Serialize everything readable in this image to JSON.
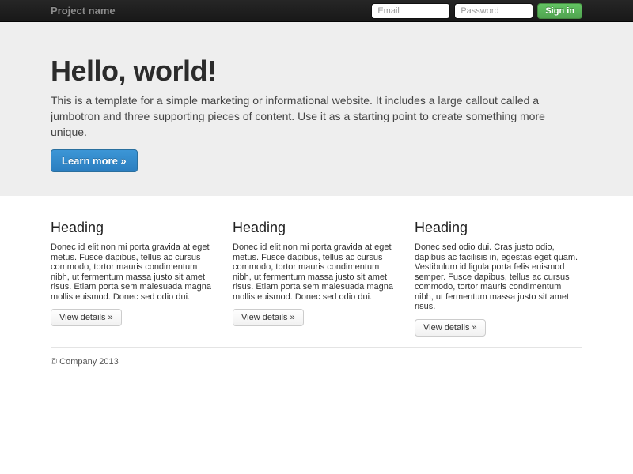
{
  "navbar": {
    "brand": "Project name",
    "email_placeholder": "Email",
    "password_placeholder": "Password",
    "signin_label": "Sign in"
  },
  "jumbotron": {
    "title": "Hello, world!",
    "description": "This is a template for a simple marketing or informational website. It includes a large callout called a jumbotron and three supporting pieces of content. Use it as a starting point to create something more unique.",
    "cta_label": "Learn more »"
  },
  "columns": [
    {
      "heading": "Heading",
      "text": "Donec id elit non mi porta gravida at eget metus. Fusce dapibus, tellus ac cursus commodo, tortor mauris condimentum nibh, ut fermentum massa justo sit amet risus. Etiam porta sem malesuada magna mollis euismod. Donec sed odio dui.",
      "cta_label": "View details »"
    },
    {
      "heading": "Heading",
      "text": "Donec id elit non mi porta gravida at eget metus. Fusce dapibus, tellus ac cursus commodo, tortor mauris condimentum nibh, ut fermentum massa justo sit amet risus. Etiam porta sem malesuada magna mollis euismod. Donec sed odio dui.",
      "cta_label": "View details »"
    },
    {
      "heading": "Heading",
      "text": "Donec sed odio dui. Cras justo odio, dapibus ac facilisis in, egestas eget quam. Vestibulum id ligula porta felis euismod semper. Fusce dapibus, tellus ac cursus commodo, tortor mauris condimentum nibh, ut fermentum massa justo sit amet risus.",
      "cta_label": "View details »"
    }
  ],
  "footer": {
    "copyright": "© Company 2013"
  },
  "colors": {
    "navbar_bg": "#1e1e1e",
    "jumbotron_bg": "#eeeeee",
    "primary_button": "#3c96d6",
    "success_button": "#5cb85c"
  }
}
